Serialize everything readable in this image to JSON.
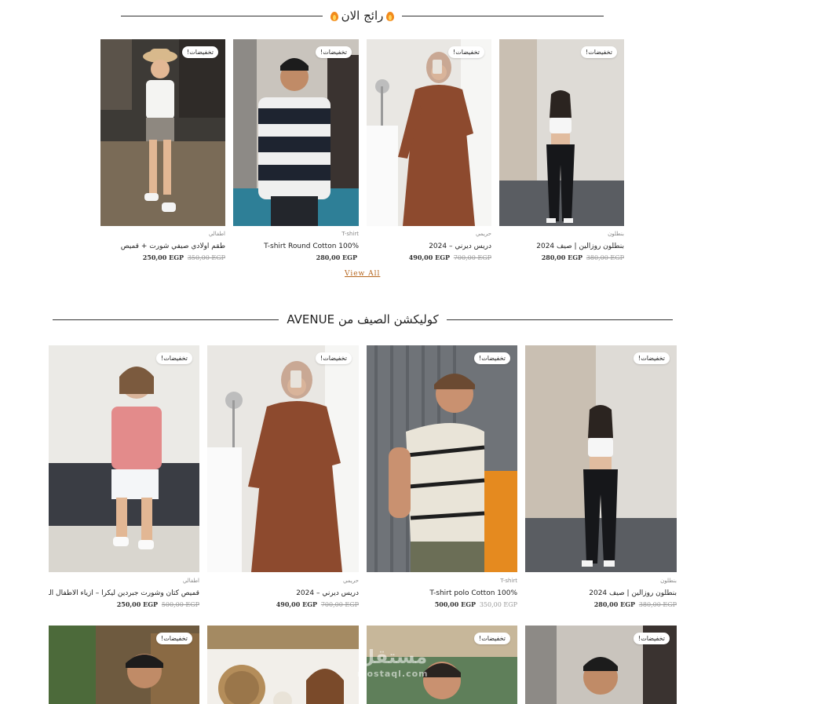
{
  "trending": {
    "title": "رائج الان",
    "view_all": "View All",
    "products": [
      {
        "badge": "تخفيضات!",
        "category": "اطفالي",
        "name": "طقم اولادي صيفي شورت + قميص",
        "price": "250,00 EGP",
        "old_price": "350,00 EGP"
      },
      {
        "badge": "تخفيضات!",
        "category": "T-shirt",
        "name": "T-shirt Round Cotton 100%",
        "price": "280,00 EGP",
        "old_price": ""
      },
      {
        "badge": "تخفيضات!",
        "category": "حريمي",
        "name": "دريس ديرني – 2024",
        "price": "490,00 EGP",
        "old_price": "700,00 EGP"
      },
      {
        "badge": "تخفيضات!",
        "category": "بنطلون",
        "name": "بنطلون روزالين | صيف 2024",
        "price": "280,00 EGP",
        "old_price": "380,00 EGP"
      }
    ]
  },
  "summer": {
    "title": "كوليكشن الصيف من AVENUE",
    "products": [
      {
        "badge": "تخفيضات!",
        "category": "اطفالي",
        "name": "قميص كتان وشورت جبردين ليكرا – أزياء الأطفال الصيفية",
        "price": "250,00 EGP",
        "old_price": "500,00 EGP"
      },
      {
        "badge": "تخفيضات!",
        "category": "حريمي",
        "name": "دريس ديرني – 2024",
        "price": "490,00 EGP",
        "old_price": "700,00 EGP"
      },
      {
        "badge": "تخفيضات!",
        "category": "T-shirt",
        "name": "T-shirt polo Cotton 100%",
        "price": "500,00 EGP",
        "old_price": "350,00 EGP"
      },
      {
        "badge": "تخفيضات!",
        "category": "بنطلون",
        "name": "بنطلون روزالين | صيف 2024",
        "price": "280,00 EGP",
        "old_price": "380,00 EGP"
      }
    ],
    "row2_badges": [
      "تخفيضات!",
      "تخفيضات!",
      "تخفيضات!"
    ]
  },
  "watermark": {
    "line1": "مستقل",
    "line2": "mostaql.com"
  },
  "colors": {
    "accent": "#b5651d",
    "flame": "#f28a1c"
  }
}
